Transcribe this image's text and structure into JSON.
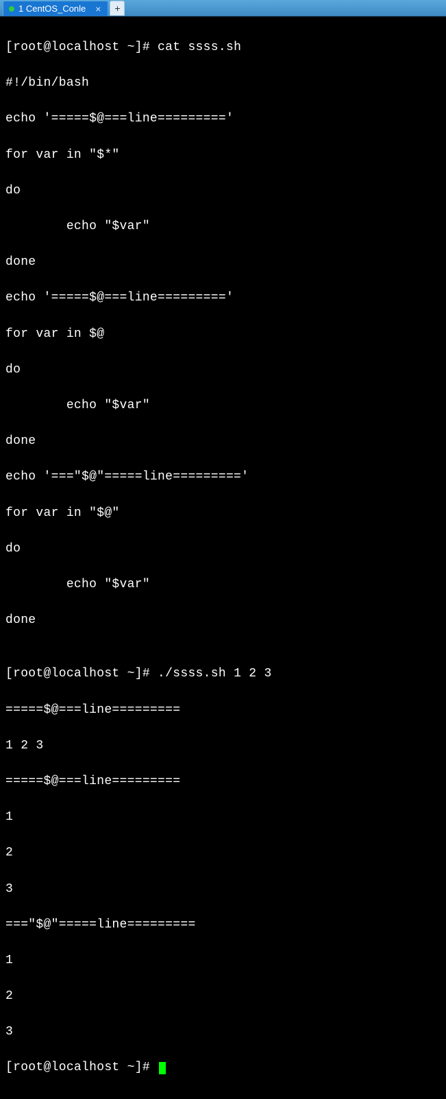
{
  "titlebar": {
    "tab_label": "1 CentOS_Conle",
    "close_glyph": "×",
    "newtab_glyph": "+"
  },
  "terminal": {
    "prompt1": "[root@localhost ~]# ",
    "cmd1": "cat ssss.sh",
    "script": {
      "l1": "#!/bin/bash",
      "l2": "echo '=====$@===line========='",
      "l3": "for var in \"$*\"",
      "l4": "do",
      "l5": "        echo \"$var\"",
      "l6": "done",
      "l7": "echo '=====$@===line========='",
      "l8": "for var in $@",
      "l9": "do",
      "l10": "        echo \"$var\"",
      "l11": "done",
      "l12": "echo '===\"$@\"=====line========='",
      "l13": "for var in \"$@\"",
      "l14": "do",
      "l15": "        echo \"$var\"",
      "l16": "done"
    },
    "blank": "",
    "prompt2": "[root@localhost ~]# ",
    "cmd2": "./ssss.sh 1 2 3",
    "out": {
      "o1": "=====$@===line=========",
      "o2": "1 2 3",
      "o3": "=====$@===line=========",
      "o4": "1",
      "o5": "2",
      "o6": "3",
      "o7": "===\"$@\"=====line=========",
      "o8": "1",
      "o9": "2",
      "o10": "3"
    },
    "prompt3": "[root@localhost ~]# "
  }
}
